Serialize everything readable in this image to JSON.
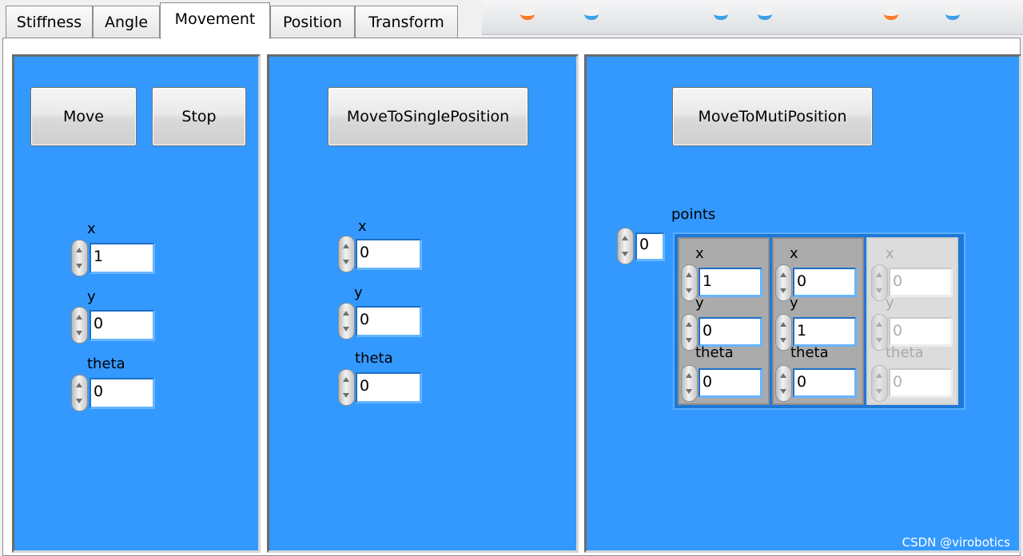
{
  "tabs": [
    {
      "label": "Stiffness",
      "active": false
    },
    {
      "label": "Angle",
      "active": false
    },
    {
      "label": "Movement",
      "active": true
    },
    {
      "label": "Position",
      "active": false
    },
    {
      "label": "Transform",
      "active": false
    }
  ],
  "colors": {
    "panel_bg": "#3399ff",
    "tab_bg": "#f0f0f0"
  },
  "move_panel": {
    "move_label": "Move",
    "stop_label": "Stop",
    "fields": [
      {
        "label": "x",
        "value": "1"
      },
      {
        "label": "y",
        "value": "0"
      },
      {
        "label": "theta",
        "value": "0"
      }
    ]
  },
  "single_panel": {
    "button_label": "MoveToSinglePosition",
    "fields": [
      {
        "label": "x",
        "value": "0"
      },
      {
        "label": "y",
        "value": "0"
      },
      {
        "label": "theta",
        "value": "0"
      }
    ]
  },
  "multi_panel": {
    "button_label": "MoveToMutiPosition",
    "array_label": "points",
    "index_value": "0",
    "elements": [
      {
        "x": "1",
        "y": "0",
        "theta": "0"
      },
      {
        "x": "0",
        "y": "1",
        "theta": "0"
      },
      {
        "x": "0",
        "y": "0",
        "theta": "0"
      }
    ],
    "labels": {
      "x": "x",
      "y": "y",
      "theta": "theta"
    }
  },
  "watermark": "CSDN @virobotics"
}
